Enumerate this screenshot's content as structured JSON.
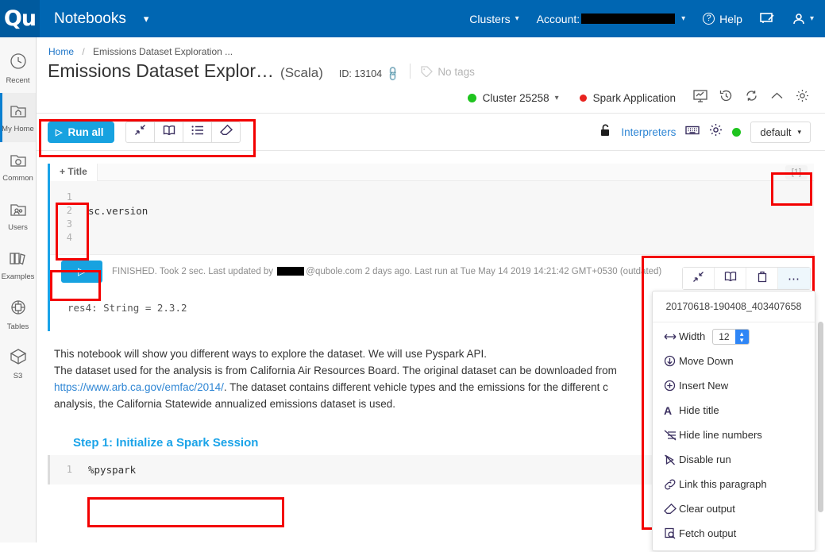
{
  "header": {
    "logo": "Qu",
    "app_section": "Notebooks",
    "clusters_label": "Clusters",
    "account_label": "Account:",
    "account_value_redacted": true,
    "help_label": "Help",
    "feedback_icon": "feedback-icon",
    "user_icon": "user-icon"
  },
  "sidebar": {
    "items": [
      {
        "label": "Recent",
        "icon": "clock-icon",
        "active": false
      },
      {
        "label": "My Home",
        "icon": "home-folder-icon",
        "active": true
      },
      {
        "label": "Common",
        "icon": "common-folder-icon",
        "active": false
      },
      {
        "label": "Users",
        "icon": "users-folder-icon",
        "active": false
      },
      {
        "label": "Examples",
        "icon": "books-icon",
        "active": false
      },
      {
        "label": "Tables",
        "icon": "tables-icon",
        "active": false
      },
      {
        "label": "S3",
        "icon": "cube-icon",
        "active": false
      }
    ]
  },
  "breadcrumb": {
    "home": "Home",
    "separator": "/",
    "current": "Emissions Dataset Exploration ..."
  },
  "notebook": {
    "title": "Emissions Dataset Explor…",
    "language": "(Scala)",
    "id_label": "ID: 13104",
    "tags_label": "No tags"
  },
  "cluster_bar": {
    "cluster_name": "Cluster 25258",
    "cluster_status_color": "#1fc41f",
    "spark_label": "Spark Application",
    "spark_status_color": "#e8231f",
    "icons": [
      "monitor-chart-icon",
      "history-icon",
      "refresh-icon",
      "chevron-up-icon",
      "gear-icon"
    ]
  },
  "toolbar": {
    "run_all_label": "Run all",
    "buttons": [
      "collapse-icon",
      "book-icon",
      "list-icon",
      "eraser-icon"
    ],
    "lock_icon": "unlock-icon",
    "interpreters_label": "Interpreters",
    "keyboard_icon": "keyboard-icon",
    "gear_icon": "gear-icon",
    "status_color": "#1fc41f",
    "default_select": "default"
  },
  "paragraph1": {
    "add_title_label": "+ Title",
    "badge": "[1]",
    "line_numbers": [
      "1",
      "2",
      "3",
      "4"
    ],
    "code_lines": [
      "",
      "sc.version",
      "",
      ""
    ],
    "run_icon": "play-icon",
    "status_text": "FINISHED. Took 2 sec. Last updated by ",
    "status_text_2": "@qubole.com 2 days ago. Last run at Tue May 14 2019 14:21:42 GMT+0530 (outdated)",
    "output": "res4: String = 2.3.2"
  },
  "markdown": {
    "line1": "This notebook will show you different ways to explore the dataset. We will use Pyspark API.",
    "line2": "The dataset used for the analysis is from California Air Resources Board. The original dataset can be downloaded from",
    "link": "https://www.arb.ca.gov/emfac/2014/",
    "line3_after_link": ". The dataset contains different vehicle types and the emissions for the different c",
    "line4": "analysis, the California Statewide annualized emissions dataset is used."
  },
  "step1": {
    "heading": "Step 1: Initialize a Spark Session",
    "line_number": "1",
    "code": "%pyspark"
  },
  "context_menu": {
    "toolbar_icons": [
      "collapse-icon",
      "book-icon",
      "trash-icon",
      "ellipsis-icon"
    ],
    "paragraph_id": "20170618-190408_403407658",
    "width_label": "Width",
    "width_value": "12",
    "items": [
      {
        "label": "Move Down",
        "icon": "arrow-down-circle-icon"
      },
      {
        "label": "Insert New",
        "icon": "plus-circle-icon"
      },
      {
        "label": "Hide title",
        "icon": "font-a-icon"
      },
      {
        "label": "Hide line numbers",
        "icon": "line-numbers-off-icon"
      },
      {
        "label": "Disable run",
        "icon": "play-disabled-icon"
      },
      {
        "label": "Link this paragraph",
        "icon": "link-icon"
      },
      {
        "label": "Clear output",
        "icon": "eraser-icon"
      },
      {
        "label": "Fetch output",
        "icon": "fetch-icon"
      }
    ]
  },
  "colors": {
    "header_blue": "#0066b2",
    "accent_blue": "#17a2e0",
    "link_blue": "#2f86d4",
    "annotation_red": "#f30000"
  }
}
